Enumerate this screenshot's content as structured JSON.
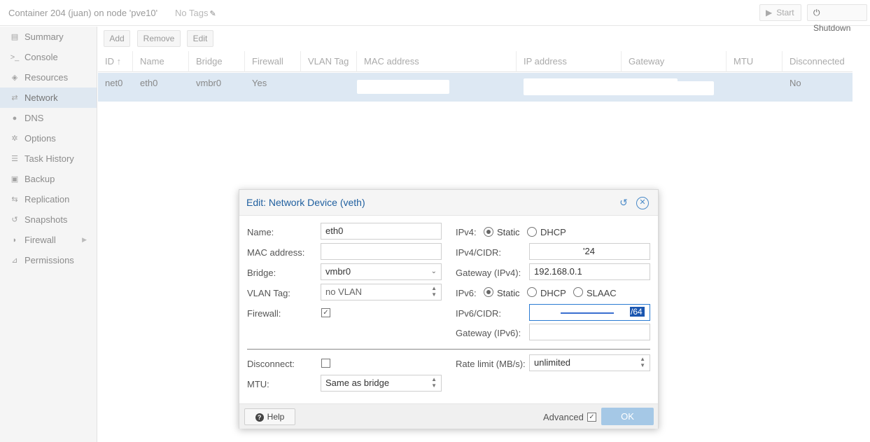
{
  "header": {
    "title": "Container 204 (juan) on node 'pve10'",
    "tags": "No Tags",
    "start_label": "Start",
    "shutdown_label": "Shutdown"
  },
  "sidebar": {
    "items": [
      {
        "label": "Summary",
        "icon": "book-icon"
      },
      {
        "label": "Console",
        "icon": "terminal-icon"
      },
      {
        "label": "Resources",
        "icon": "cube-icon"
      },
      {
        "label": "Network",
        "icon": "exchange-icon"
      },
      {
        "label": "DNS",
        "icon": "globe-icon"
      },
      {
        "label": "Options",
        "icon": "gear-icon"
      },
      {
        "label": "Task History",
        "icon": "list-icon"
      },
      {
        "label": "Backup",
        "icon": "floppy-icon"
      },
      {
        "label": "Replication",
        "icon": "retweet-icon"
      },
      {
        "label": "Snapshots",
        "icon": "history-icon"
      },
      {
        "label": "Firewall",
        "icon": "shield-icon"
      },
      {
        "label": "Permissions",
        "icon": "unlock-icon"
      }
    ],
    "active": "Network"
  },
  "toolbar": {
    "add_label": "Add",
    "remove_label": "Remove",
    "edit_label": "Edit"
  },
  "grid": {
    "columns": [
      "ID",
      "Name",
      "Bridge",
      "Firewall",
      "VLAN Tag",
      "MAC address",
      "IP address",
      "Gateway",
      "MTU",
      "Disconnected"
    ],
    "sort_indicator": "↑",
    "rows": [
      {
        "id": "net0",
        "name": "eth0",
        "bridge": "vmbr0",
        "firewall": "Yes",
        "vlan": "",
        "mac": "",
        "ip": "",
        "gateway": "",
        "mtu": "",
        "disconnected": "No"
      }
    ]
  },
  "dialog": {
    "title": "Edit: Network Device (veth)",
    "name_label": "Name:",
    "name_value": "eth0",
    "mac_label": "MAC address:",
    "mac_value": "",
    "bridge_label": "Bridge:",
    "bridge_value": "vmbr0",
    "vlan_label": "VLAN Tag:",
    "vlan_value": "no VLAN",
    "firewall_label": "Firewall:",
    "firewall_checked": true,
    "ipv4_label": "IPv4:",
    "ipv4_static_label": "Static",
    "ipv4_dhcp_label": "DHCP",
    "ipv4_mode": "Static",
    "ipv4_cidr_label": "IPv4/CIDR:",
    "ipv4_cidr_value": "'24",
    "gateway4_label": "Gateway (IPv4):",
    "gateway4_value": "192.168.0.1",
    "ipv6_label": "IPv6:",
    "ipv6_static_label": "Static",
    "ipv6_dhcp_label": "DHCP",
    "ipv6_slaac_label": "SLAAC",
    "ipv6_mode": "Static",
    "ipv6_cidr_label": "IPv6/CIDR:",
    "ipv6_cidr_value": "/64",
    "gateway6_label": "Gateway (IPv6):",
    "gateway6_value": "",
    "disconnect_label": "Disconnect:",
    "disconnect_checked": false,
    "mtu_label": "MTU:",
    "mtu_value": "Same as bridge",
    "rate_label": "Rate limit (MB/s):",
    "rate_value": "unlimited",
    "help_label": "Help",
    "advanced_label": "Advanced",
    "advanced_checked": true,
    "ok_label": "OK"
  }
}
